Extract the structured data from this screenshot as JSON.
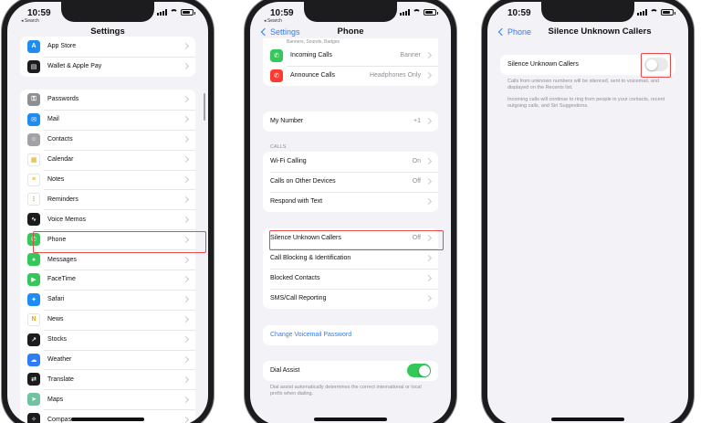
{
  "status": {
    "time": "10:59",
    "back_app": "◂ Search"
  },
  "settings": {
    "title": "Settings",
    "group1": [
      {
        "label": "App Store",
        "icon": "app-store-icon",
        "color": "#1e8cf0",
        "glyph": "A"
      },
      {
        "label": "Wallet & Apple Pay",
        "icon": "wallet-icon",
        "color": "#1c1c1e",
        "glyph": "▤"
      }
    ],
    "group2": [
      {
        "label": "Passwords",
        "icon": "key-icon",
        "color": "#8e8e93",
        "glyph": "⚿"
      },
      {
        "label": "Mail",
        "icon": "mail-icon",
        "color": "#1e8cf0",
        "glyph": "✉"
      },
      {
        "label": "Contacts",
        "icon": "contacts-icon",
        "color": "#a2a2a6",
        "glyph": "☺"
      },
      {
        "label": "Calendar",
        "icon": "calendar-icon",
        "color": "#ffffff",
        "glyph": "▦"
      },
      {
        "label": "Notes",
        "icon": "notes-icon",
        "color": "#ffffff",
        "glyph": "≡"
      },
      {
        "label": "Reminders",
        "icon": "reminders-icon",
        "color": "#ffffff",
        "glyph": "⋮"
      },
      {
        "label": "Voice Memos",
        "icon": "voice-memos-icon",
        "color": "#1c1c1e",
        "glyph": "∿"
      },
      {
        "label": "Phone",
        "icon": "phone-icon",
        "color": "#34c759",
        "glyph": "✆"
      },
      {
        "label": "Messages",
        "icon": "messages-icon",
        "color": "#34c759",
        "glyph": "●"
      },
      {
        "label": "FaceTime",
        "icon": "facetime-icon",
        "color": "#34c759",
        "glyph": "▶"
      },
      {
        "label": "Safari",
        "icon": "safari-icon",
        "color": "#1e8cf0",
        "glyph": "✦"
      },
      {
        "label": "News",
        "icon": "news-icon",
        "color": "#ffffff",
        "glyph": "N"
      },
      {
        "label": "Stocks",
        "icon": "stocks-icon",
        "color": "#1c1c1e",
        "glyph": "↗"
      },
      {
        "label": "Weather",
        "icon": "weather-icon",
        "color": "#2f7cf6",
        "glyph": "☁"
      },
      {
        "label": "Translate",
        "icon": "translate-icon",
        "color": "#1c1c1e",
        "glyph": "⇄"
      },
      {
        "label": "Maps",
        "icon": "maps-icon",
        "color": "#6fc3a0",
        "glyph": "➤"
      },
      {
        "label": "Compass",
        "icon": "compass-icon",
        "color": "#1c1c1e",
        "glyph": "✧"
      }
    ]
  },
  "phone": {
    "back": "Settings",
    "title": "Phone",
    "top_partial": "Banners, Sounds, Badges",
    "notif_rows": [
      {
        "label": "Incoming Calls",
        "value": "Banner",
        "icon": "incoming-calls-icon",
        "color": "#34c759",
        "glyph": "✆"
      },
      {
        "label": "Announce Calls",
        "value": "Headphones Only",
        "icon": "announce-calls-icon",
        "color": "#ff3b30",
        "glyph": "✆"
      }
    ],
    "my_number": {
      "label": "My Number",
      "value": "+1"
    },
    "calls_header": "CALLS",
    "calls_rows": [
      {
        "label": "Wi-Fi Calling",
        "value": "On"
      },
      {
        "label": "Calls on Other Devices",
        "value": "Off"
      },
      {
        "label": "Respond with Text",
        "value": ""
      }
    ],
    "silence_rows": [
      {
        "label": "Silence Unknown Callers",
        "value": "Off"
      },
      {
        "label": "Call Blocking & Identification",
        "value": ""
      },
      {
        "label": "Blocked Contacts",
        "value": ""
      },
      {
        "label": "SMS/Call Reporting",
        "value": ""
      }
    ],
    "voicemail_link": "Change Voicemail Password",
    "dial_assist": {
      "label": "Dial Assist",
      "on": true
    },
    "dial_assist_footer": "Dial assist automatically determines the correct international or local prefix when dialing."
  },
  "silence": {
    "back": "Phone",
    "title": "Silence Unknown Callers",
    "row_label": "Silence Unknown Callers",
    "toggle_on": false,
    "footer1": "Calls from unknown numbers will be silenced, sent to voicemail, and displayed on the Recents list.",
    "footer2": "Incoming calls will continue to ring from people in your contacts, recent outgoing calls, and Siri Suggestions."
  }
}
